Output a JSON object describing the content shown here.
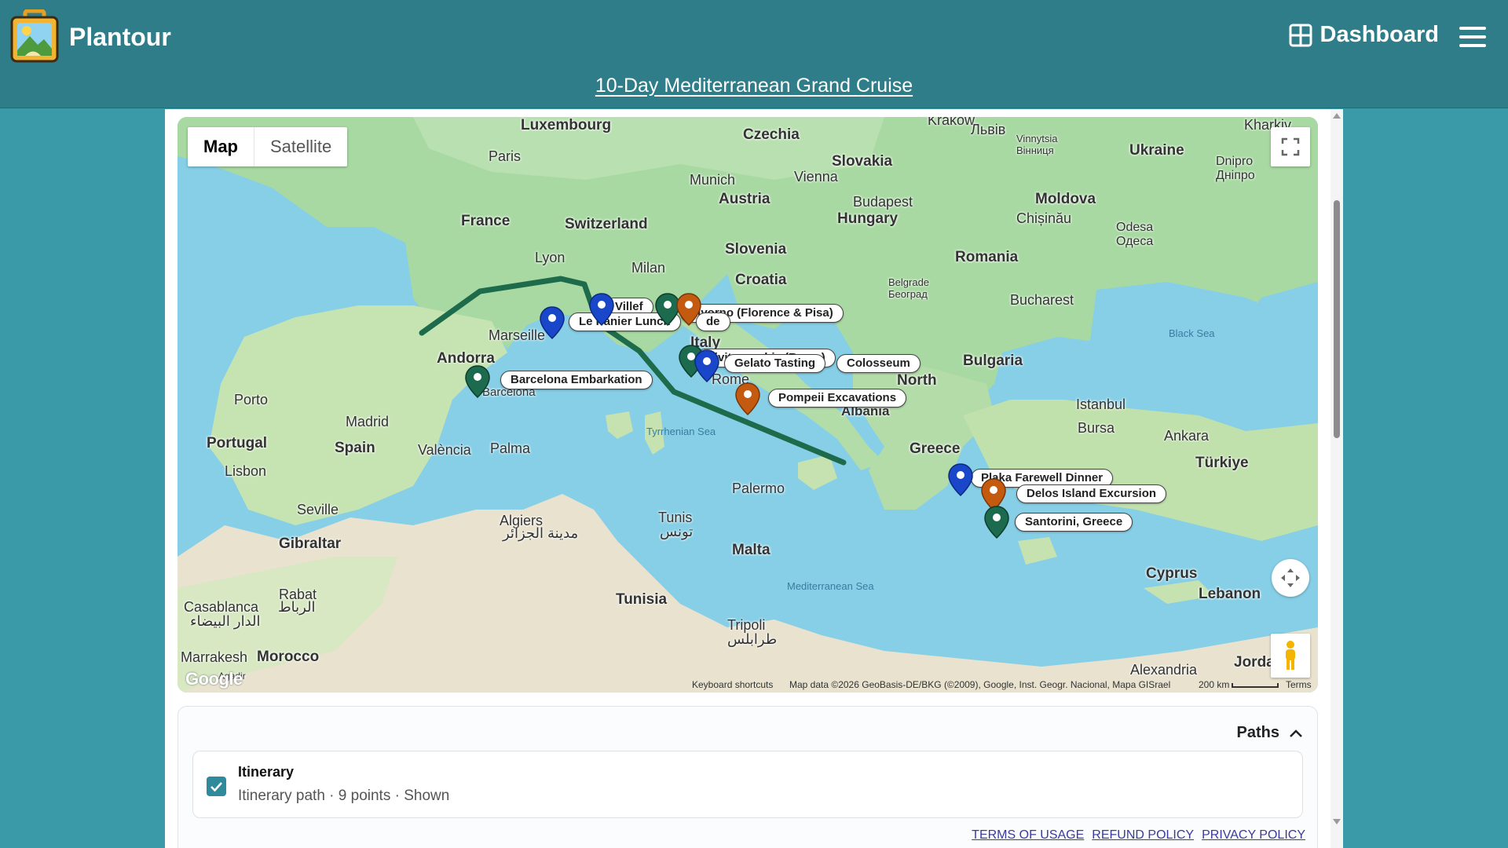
{
  "app": {
    "name": "Plantour"
  },
  "header": {
    "dashboard_label": "Dashboard",
    "trip_title": "10-Day Mediterranean Grand Cruise"
  },
  "map": {
    "type_buttons": {
      "map": "Map",
      "satellite": "Satellite"
    },
    "places": [
      {
        "name": "Luxembourg",
        "kind": "country"
      },
      {
        "name": "Czechia",
        "kind": "country"
      },
      {
        "name": "Krakow",
        "kind": "city"
      },
      {
        "name": "Львів",
        "kind": "city"
      },
      {
        "name": "Vinnytsia Вінниця",
        "kind": "city"
      },
      {
        "name": "Kharkiv",
        "kind": "city"
      },
      {
        "name": "Ukraine",
        "kind": "country"
      },
      {
        "name": "Paris",
        "kind": "city"
      },
      {
        "name": "Slovakia",
        "kind": "country"
      },
      {
        "name": "Dnipro Дніпро",
        "kind": "city"
      },
      {
        "name": "Munich",
        "kind": "city"
      },
      {
        "name": "Vienna",
        "kind": "city"
      },
      {
        "name": "Austria",
        "kind": "country"
      },
      {
        "name": "Budapest",
        "kind": "city"
      },
      {
        "name": "Moldova",
        "kind": "country"
      },
      {
        "name": "France",
        "kind": "country"
      },
      {
        "name": "Switzerland",
        "kind": "country"
      },
      {
        "name": "Hungary",
        "kind": "country"
      },
      {
        "name": "Chișinău",
        "kind": "city"
      },
      {
        "name": "Odesa Одеса",
        "kind": "city"
      },
      {
        "name": "Lyon",
        "kind": "city"
      },
      {
        "name": "Milan",
        "kind": "city"
      },
      {
        "name": "Slovenia",
        "kind": "country"
      },
      {
        "name": "Romania",
        "kind": "country"
      },
      {
        "name": "Croatia",
        "kind": "country"
      },
      {
        "name": "Belgrade Београд",
        "kind": "city"
      },
      {
        "name": "Bucharest",
        "kind": "city"
      },
      {
        "name": "Marseille",
        "kind": "city"
      },
      {
        "name": "Black Sea",
        "kind": "sea"
      },
      {
        "name": "Andorra",
        "kind": "country"
      },
      {
        "name": "Italy",
        "kind": "country"
      },
      {
        "name": "Bulgaria",
        "kind": "country"
      },
      {
        "name": "Barcelona",
        "kind": "city"
      },
      {
        "name": "Rome",
        "kind": "city"
      },
      {
        "name": "North",
        "kind": "country"
      },
      {
        "name": "Porto",
        "kind": "city"
      },
      {
        "name": "Albania",
        "kind": "country"
      },
      {
        "name": "Istanbul",
        "kind": "city"
      },
      {
        "name": "Madrid",
        "kind": "city"
      },
      {
        "name": "Bursa",
        "kind": "city"
      },
      {
        "name": "Tyrrhenian Sea",
        "kind": "sea"
      },
      {
        "name": "Ankara",
        "kind": "city"
      },
      {
        "name": "Portugal",
        "kind": "country"
      },
      {
        "name": "València",
        "kind": "city"
      },
      {
        "name": "Palma",
        "kind": "city"
      },
      {
        "name": "Spain",
        "kind": "country"
      },
      {
        "name": "Greece",
        "kind": "country"
      },
      {
        "name": "Türkiye",
        "kind": "country"
      },
      {
        "name": "Lisbon",
        "kind": "city"
      },
      {
        "name": "Palermo",
        "kind": "city"
      },
      {
        "name": "Seville",
        "kind": "city"
      },
      {
        "name": "Algiers",
        "kind": "city"
      },
      {
        "name": "Tunis",
        "kind": "city"
      },
      {
        "name": "مدينة الجزائر",
        "kind": "city"
      },
      {
        "name": "تونس",
        "kind": "city"
      },
      {
        "name": "Gibraltar",
        "kind": "country"
      },
      {
        "name": "Malta",
        "kind": "country"
      },
      {
        "name": "Cyprus",
        "kind": "country"
      },
      {
        "name": "Mediterranean Sea",
        "kind": "sea"
      },
      {
        "name": "Rabat",
        "kind": "city"
      },
      {
        "name": "Casablanca",
        "kind": "city"
      },
      {
        "name": "Tunisia",
        "kind": "country"
      },
      {
        "name": "Lebanon",
        "kind": "country"
      },
      {
        "name": "الرباط",
        "kind": "city"
      },
      {
        "name": "الدار البيضاء",
        "kind": "city"
      },
      {
        "name": "Tripoli",
        "kind": "city"
      },
      {
        "name": "طرابلس",
        "kind": "city"
      },
      {
        "name": "Marrakesh",
        "kind": "city"
      },
      {
        "name": "Morocco",
        "kind": "country"
      },
      {
        "name": "Alexandria",
        "kind": "city"
      },
      {
        "name": "Jorda",
        "kind": "country"
      },
      {
        "name": "Agadir",
        "kind": "city"
      }
    ],
    "markers": [
      {
        "label": "Villef",
        "color": "#1a47c9",
        "icon": "dot-pin-icon"
      },
      {
        "label": "Livorno (Florence & Pisa)",
        "color": "#1c6b4f",
        "icon": "dot-pin-icon"
      },
      {
        "label": "de",
        "color": "#c45a10",
        "icon": "dot-pin-icon"
      },
      {
        "label": "Le Panier Lunch",
        "color": "#1a47c9",
        "icon": "dot-pin-icon"
      },
      {
        "label": "Barcelona Embarkation",
        "color": "#1c6b4f",
        "icon": "dot-pin-icon"
      },
      {
        "label": "Civitavecchia (Rome)",
        "color": "#1c6b4f",
        "icon": "dot-pin-icon"
      },
      {
        "label": "Gelato Tasting",
        "color": "#1a47c9",
        "icon": "dot-pin-icon"
      },
      {
        "label": "Colosseum",
        "color": "#c45a10",
        "icon": "dot-pin-icon"
      },
      {
        "label": "Pompeii Excavations",
        "color": "#c45a10",
        "icon": "dot-pin-icon"
      },
      {
        "label": "Plaka Farewell Dinner",
        "color": "#1a47c9",
        "icon": "dot-pin-icon"
      },
      {
        "label": "Delos Island Excursion",
        "color": "#c45a10",
        "icon": "dot-pin-icon"
      },
      {
        "label": "Santorini, Greece",
        "color": "#1c6b4f",
        "icon": "dot-pin-icon"
      }
    ],
    "attribution": {
      "shortcuts": "Keyboard shortcuts",
      "data": "Map data ©2026 GeoBasis-DE/BKG (©2009), Google, Inst. Geogr. Nacional, Mapa GISrael",
      "scale": "200 km",
      "terms": "Terms"
    },
    "logo_text": "Google",
    "route_color": "#1e6b4c"
  },
  "paths": {
    "heading": "Paths",
    "items": [
      {
        "name": "Itinerary",
        "description": "Itinerary path · 9 points · Shown",
        "checked": true
      }
    ]
  },
  "footer": {
    "terms": "TERMS OF USAGE",
    "refund": "REFUND POLICY",
    "privacy": "PRIVACY POLICY"
  },
  "colors": {
    "header": "#2f7d89",
    "background": "#3a9aa8",
    "accent": "#2f8b9b"
  }
}
